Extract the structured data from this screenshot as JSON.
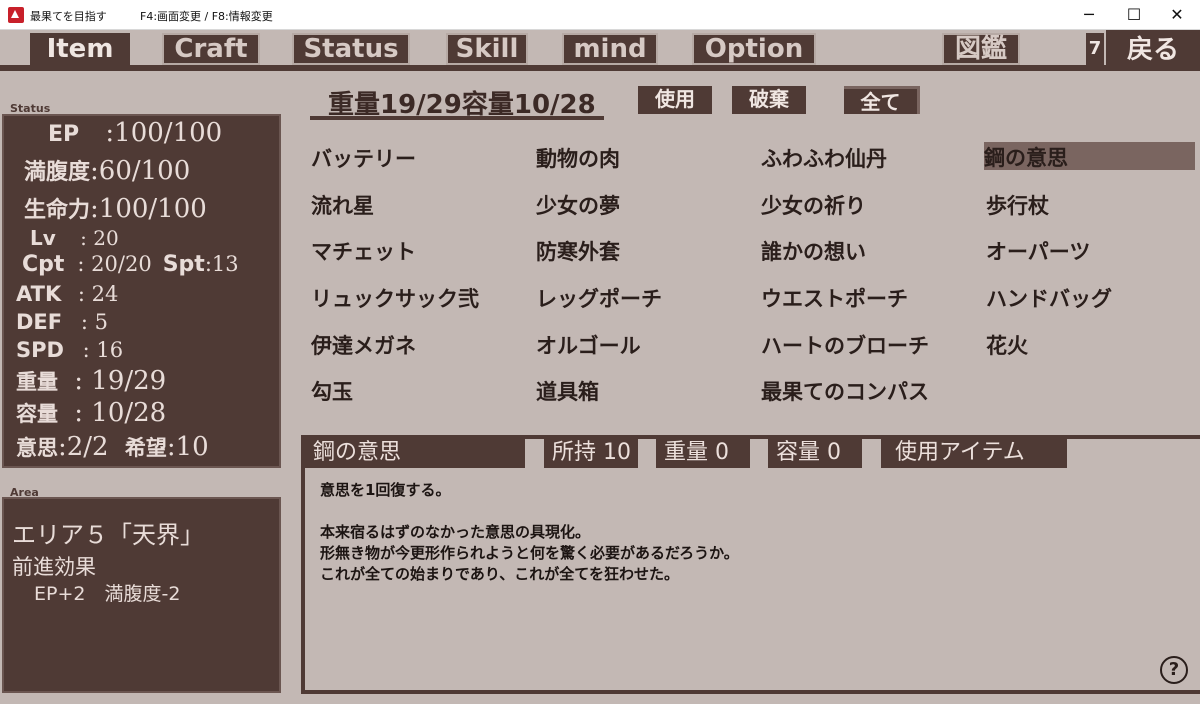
{
  "window": {
    "title": "最果てを目指す",
    "hint": "F4:画面変更 / F8:情報変更",
    "minimize": "─",
    "maximize": "☐",
    "close": "✕"
  },
  "tabs": [
    "Item",
    "Craft",
    "Status",
    "Skill",
    "mind",
    "Option",
    "図鑑"
  ],
  "back_button": "戻る",
  "back_marker": "7",
  "status": {
    "section_label": "Status",
    "ep_label": "EP",
    "ep": ":100/100",
    "hunger_label": "満腹度",
    "hunger": ":60/100",
    "life_label": "生命力",
    "life": ":100/100",
    "lv_label": "Lv",
    "lv": ": 20",
    "cpt_label": "Cpt",
    "cpt": ": 20/20",
    "spt_label": "Spt",
    "spt": ":13",
    "atk_label": "ATK",
    "atk": ": 24",
    "def_label": "DEF",
    "def": ": 5",
    "spd_label": "SPD",
    "spd": ": 16",
    "weight_label": "重量",
    "weight": ": 19/29",
    "capacity_label": "容量",
    "capacity": ": 10/28",
    "will_label": "意思",
    "will": ":2/2",
    "hope_label": "希望",
    "hope": ":10"
  },
  "area": {
    "section_label": "Area",
    "name": "エリア５「天界」",
    "effect_label": "前進効果",
    "effect": "EP+2　満腹度-2"
  },
  "inventory": {
    "header": "重量19/29容量10/28",
    "use_button": "使用",
    "discard_button": "破棄",
    "filter_button": "全て",
    "items": [
      [
        "バッテリー",
        "動物の肉",
        "ふわふわ仙丹",
        "鋼の意思"
      ],
      [
        "流れ星",
        "少女の夢",
        "少女の祈り",
        "歩行杖"
      ],
      [
        "マチェット",
        "防寒外套",
        "誰かの想い",
        "オーパーツ"
      ],
      [
        "リュックサック弐",
        "レッグポーチ",
        "ウエストポーチ",
        "ハンドバッグ"
      ],
      [
        "伊達メガネ",
        "オルゴール",
        "ハートのブローチ",
        "花火"
      ],
      [
        "勾玉",
        "道具箱",
        "最果てのコンパス",
        ""
      ]
    ],
    "selected": "鋼の意思"
  },
  "detail": {
    "name": "鋼の意思",
    "owned": "所持 10",
    "weight": "重量 0",
    "capacity": "容量 0",
    "type": "使用アイテム",
    "description": "意思を1回復する。\n\n本来宿るはずのなかった意思の具現化。\n形無き物が今更形作られようと何を驚く必要があるだろうか。\nこれが全ての始まりであり、これが全てを狂わせた。",
    "help": "?"
  }
}
